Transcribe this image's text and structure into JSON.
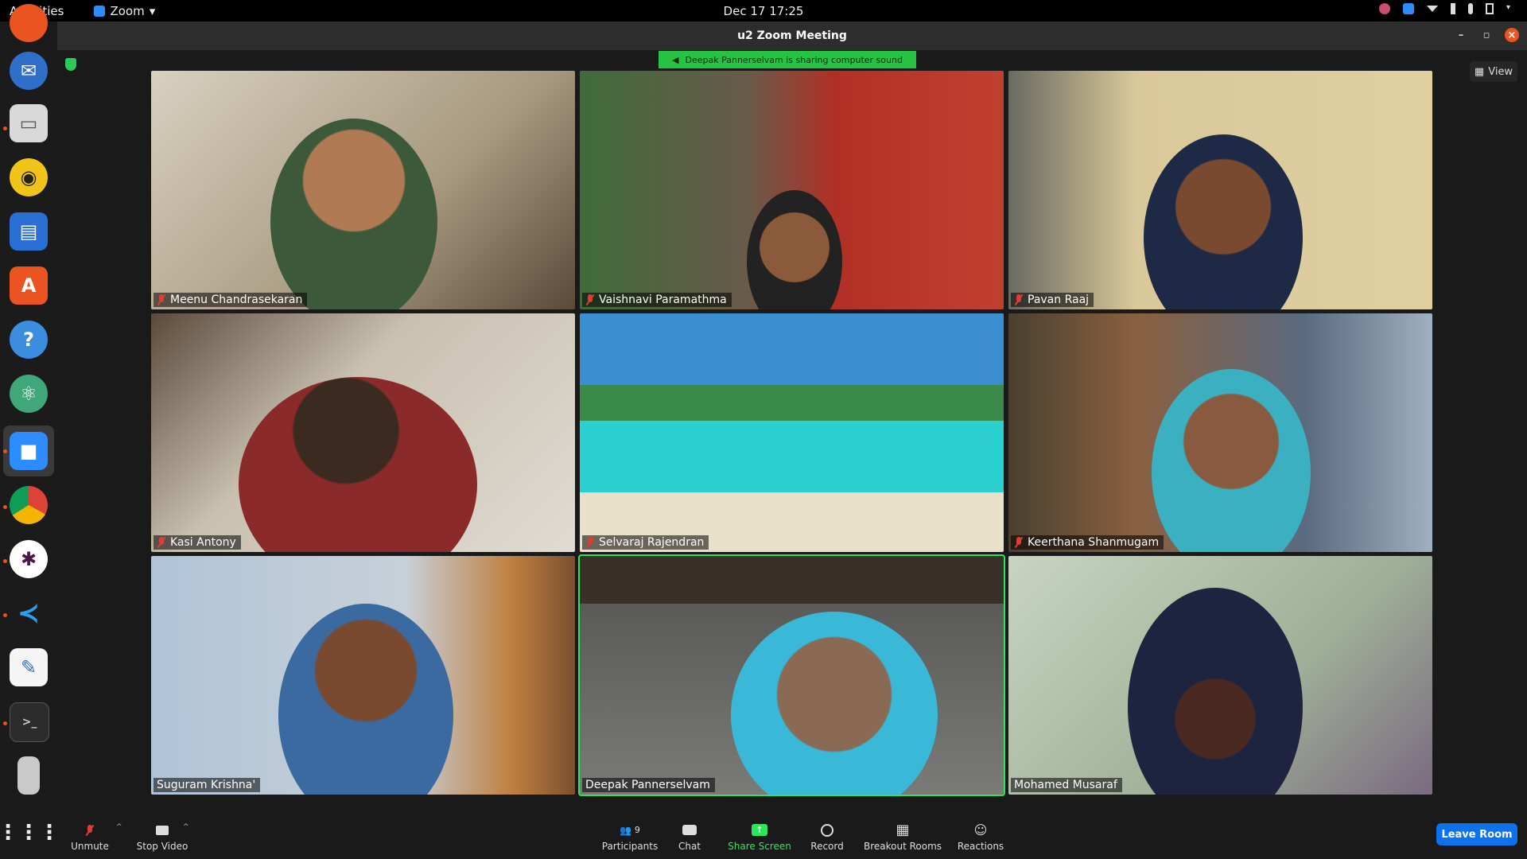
{
  "topbar": {
    "activities": "Activities",
    "app_menu": "Zoom",
    "clock": "Dec 17  17:25"
  },
  "window": {
    "title": "u2  Zoom Meeting"
  },
  "banner": {
    "text": "Deepak Pannerselvam is sharing computer sound"
  },
  "view_button": {
    "label": "View"
  },
  "participants": [
    {
      "name": "Meenu Chandrasekaran",
      "muted": true
    },
    {
      "name": "Vaishnavi Paramathma",
      "muted": true
    },
    {
      "name": "Pavan Raaj",
      "muted": true
    },
    {
      "name": "Kasi Antony",
      "muted": true
    },
    {
      "name": "Selvaraj Rajendran",
      "muted": true
    },
    {
      "name": "Keerthana Shanmugam",
      "muted": true
    },
    {
      "name": "Suguram Krishna'",
      "muted": false
    },
    {
      "name": "Deepak Pannerselvam",
      "muted": false,
      "speaking": true
    },
    {
      "name": "Mohamed Musaraf",
      "muted": false
    }
  ],
  "toolbar": {
    "unmute": "Unmute",
    "stop_video": "Stop Video",
    "participants": "Participants",
    "participants_count": "9",
    "chat": "Chat",
    "share_screen": "Share Screen",
    "record": "Record",
    "breakout_rooms": "Breakout Rooms",
    "reactions": "Reactions",
    "leave": "Leave Room"
  },
  "colors": {
    "accent": "#0e72ed",
    "speaking": "#2ee65c",
    "banner": "#25c244"
  }
}
